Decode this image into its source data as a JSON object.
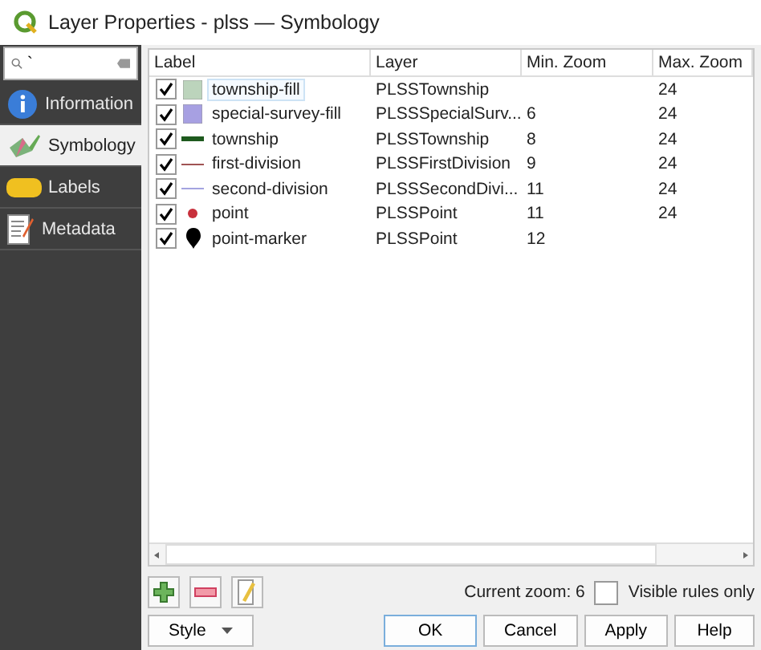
{
  "window": {
    "title": "Layer Properties - plss — Symbology"
  },
  "search": {
    "value": "`"
  },
  "sidebar": {
    "items": [
      {
        "label": "Information",
        "selected": false
      },
      {
        "label": "Symbology",
        "selected": true
      },
      {
        "label": "Labels",
        "selected": false
      },
      {
        "label": "Metadata",
        "selected": false
      }
    ]
  },
  "table": {
    "columns": [
      "Label",
      "Layer",
      "Min. Zoom",
      "Max. Zoom"
    ],
    "rows": [
      {
        "checked": true,
        "selected": true,
        "kind": "fill",
        "color": "#bcd4bc",
        "label": "township-fill",
        "layer": "PLSSTownship",
        "min_zoom": "",
        "max_zoom": "24"
      },
      {
        "checked": true,
        "selected": false,
        "kind": "fill",
        "color": "#a7a0e2",
        "label": "special-survey-fill",
        "layer": "PLSSSpecialSurv...",
        "min_zoom": "6",
        "max_zoom": "24"
      },
      {
        "checked": true,
        "selected": false,
        "kind": "thick-line",
        "color": "#1e5a1e",
        "label": "township",
        "layer": "PLSSTownship",
        "min_zoom": "8",
        "max_zoom": "24"
      },
      {
        "checked": true,
        "selected": false,
        "kind": "line",
        "color": "#a05454",
        "label": "first-division",
        "layer": "PLSSFirstDivision",
        "min_zoom": "9",
        "max_zoom": "24"
      },
      {
        "checked": true,
        "selected": false,
        "kind": "line",
        "color": "#a4a4e0",
        "label": "second-division",
        "layer": "PLSSSecondDivi...",
        "min_zoom": "11",
        "max_zoom": "24"
      },
      {
        "checked": true,
        "selected": false,
        "kind": "point",
        "color": "#c8303c",
        "label": "point",
        "layer": "PLSSPoint",
        "min_zoom": "11",
        "max_zoom": "24"
      },
      {
        "checked": true,
        "selected": false,
        "kind": "marker",
        "color": "#000000",
        "label": "point-marker",
        "layer": "PLSSPoint",
        "min_zoom": "12",
        "max_zoom": ""
      }
    ]
  },
  "current_zoom": "Current zoom: 6",
  "visible_rules_only": {
    "label": "Visible rules only",
    "checked": false
  },
  "buttons": {
    "style": "Style",
    "ok": "OK",
    "cancel": "Cancel",
    "apply": "Apply",
    "help": "Help"
  }
}
